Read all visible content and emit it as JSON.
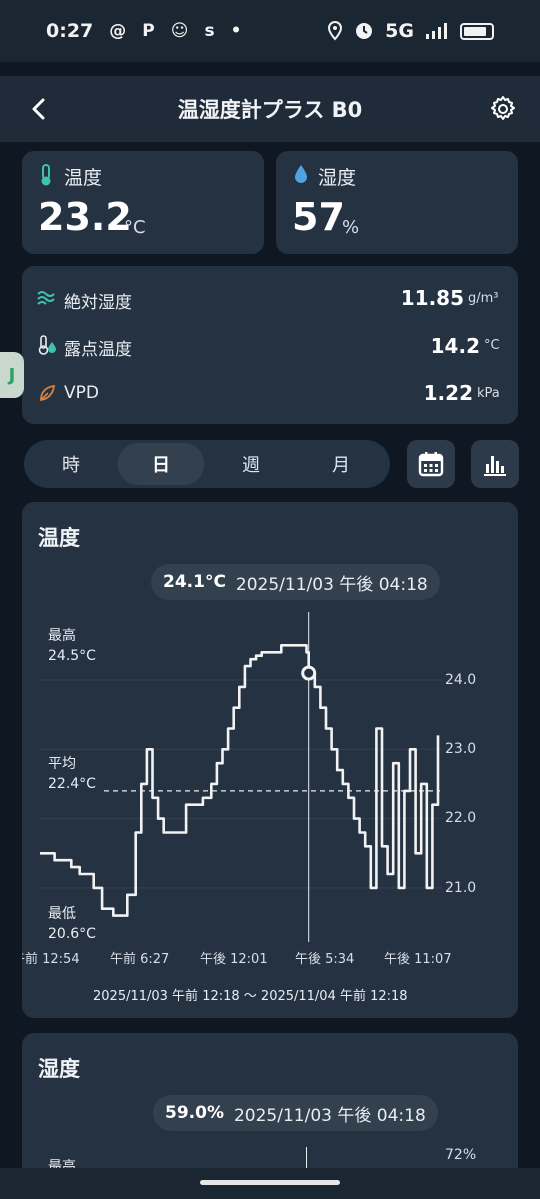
{
  "status_bar": {
    "time": "0:27",
    "app_icons": [
      "threads-icon",
      "p-icon",
      "bunny-icon",
      "s-icon",
      "dot-icon"
    ],
    "app_glyphs": [
      "@",
      "P",
      "☺",
      "s",
      "•"
    ],
    "network": "5G",
    "battery_level": 0.85
  },
  "app_bar": {
    "title": "温湿度計プラス B0"
  },
  "temperature_card": {
    "label": "温度",
    "value": "23.2",
    "unit": "°C"
  },
  "humidity_card": {
    "label": "湿度",
    "value": "57",
    "unit": "%"
  },
  "metrics": [
    {
      "label": "絶対湿度",
      "value": "11.85",
      "unit": "g/m³",
      "icon": "absolute-humidity-icon"
    },
    {
      "label": "露点温度",
      "value": "14.2",
      "unit": "°C",
      "icon": "dew-point-icon"
    },
    {
      "label": "VPD",
      "value": "1.22",
      "unit": "kPa",
      "icon": "leaf-icon"
    }
  ],
  "period_tabs": [
    {
      "label": "時",
      "active": false
    },
    {
      "label": "日",
      "active": true
    },
    {
      "label": "週",
      "active": false
    },
    {
      "label": "月",
      "active": false
    }
  ],
  "colors": {
    "accent_teal": "#3fc1b0",
    "accent_blue": "#4fa3e0",
    "accent_orange": "#e0813a",
    "card": "#253242",
    "background": "#0f1822"
  },
  "temp_chart": {
    "title": "温度",
    "pill_value": "24.1°C",
    "pill_time": "2025/11/03 午後 04:18",
    "max_label": "最高",
    "max_value": "24.5°C",
    "avg_label": "平均",
    "avg_value": "22.4°C",
    "min_label": "最低",
    "min_value": "20.6°C",
    "y_ticks": [
      "24.0",
      "23.0",
      "22.0",
      "21.0"
    ],
    "x_ticks": [
      "午前 12:54",
      "午前 6:27",
      "午後 12:01",
      "午後 5:34",
      "午後 11:07"
    ],
    "range": "2025/11/03 午前 12:18 ～ 2025/11/04 午前 12:18"
  },
  "humidity_chart": {
    "title": "湿度",
    "pill_value": "59.0%",
    "pill_time": "2025/11/03 午後 04:18",
    "max_label": "最高",
    "top_tick": "72%"
  },
  "side_tab_label": "J",
  "chart_data": {
    "type": "line",
    "title": "温度",
    "xlabel": "",
    "ylabel": "",
    "y_unit": "°C",
    "ylim": [
      20.5,
      24.5
    ],
    "x_range": [
      "2025/11/03 午前 12:18",
      "2025/11/04 午前 12:18"
    ],
    "x_tick_labels": [
      "午前 12:54",
      "午前 6:27",
      "午後 12:01",
      "午後 5:34",
      "午後 11:07"
    ],
    "grid": true,
    "average": 22.4,
    "max": 24.5,
    "min": 20.6,
    "highlight": {
      "time": "2025/11/03 午後 04:18",
      "value": 24.1
    },
    "x": [
      "00:18",
      "00:45",
      "01:10",
      "01:40",
      "02:10",
      "02:40",
      "03:10",
      "03:30",
      "04:00",
      "04:20",
      "04:40",
      "05:00",
      "05:30",
      "06:00",
      "06:20",
      "06:40",
      "07:00",
      "07:20",
      "07:40",
      "08:00",
      "08:30",
      "09:00",
      "09:30",
      "10:00",
      "10:30",
      "10:50",
      "11:10",
      "11:30",
      "11:50",
      "12:10",
      "12:30",
      "12:50",
      "13:10",
      "13:30",
      "13:50",
      "14:10",
      "14:40",
      "15:10",
      "15:40",
      "16:10",
      "16:18",
      "16:40",
      "17:00",
      "17:20",
      "17:40",
      "18:00",
      "18:20",
      "18:40",
      "19:00",
      "19:20",
      "19:40",
      "20:00",
      "20:20",
      "20:40",
      "21:00",
      "21:20",
      "21:40",
      "22:00",
      "22:20",
      "22:40",
      "23:00",
      "23:20",
      "23:40",
      "24:00"
    ],
    "series": [
      {
        "values": [
          21.5,
          21.5,
          21.4,
          21.4,
          21.3,
          21.2,
          21.2,
          21.0,
          20.7,
          20.7,
          20.6,
          20.6,
          20.9,
          21.8,
          22.5,
          23.0,
          22.3,
          22.0,
          21.8,
          21.8,
          21.8,
          22.2,
          22.2,
          22.3,
          22.5,
          22.8,
          23.0,
          23.3,
          23.6,
          23.9,
          24.2,
          24.3,
          24.35,
          24.4,
          24.4,
          24.4,
          24.5,
          24.5,
          24.5,
          24.4,
          24.1,
          23.9,
          23.6,
          23.3,
          23.0,
          22.7,
          22.5,
          22.3,
          22.0,
          21.8,
          21.6,
          21.0,
          23.3,
          21.6,
          21.2,
          22.8,
          21.0,
          22.4,
          23.0,
          21.5,
          22.5,
          21.0,
          22.2,
          23.2
        ]
      }
    ]
  }
}
